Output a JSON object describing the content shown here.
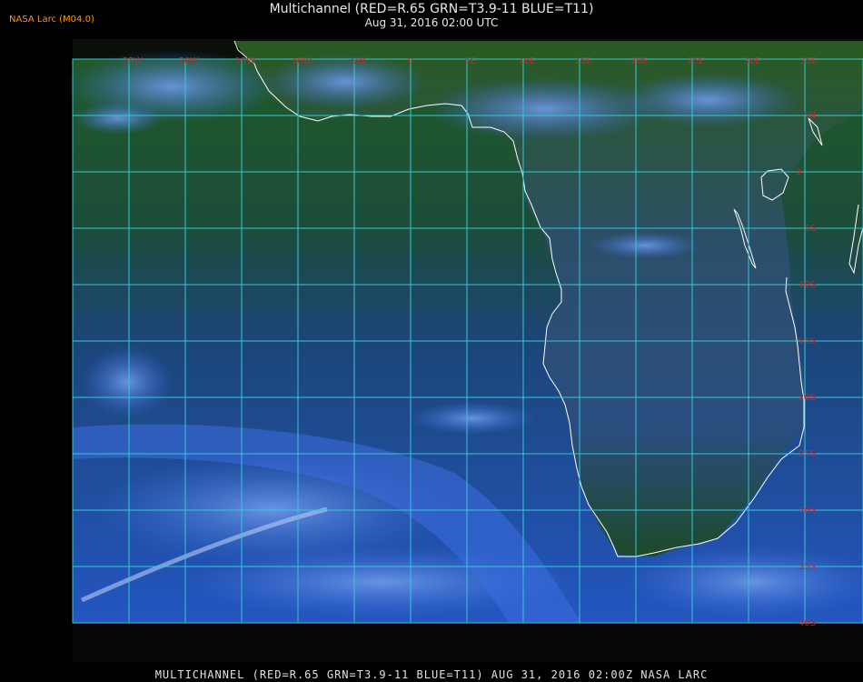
{
  "header": {
    "title": "Multichannel (RED=R.65 GRN=T3.9-11 BLUE=T11)",
    "subtitle": "Aug 31, 2016 02:00 UTC",
    "producer": "NASA Larc (M04.0)"
  },
  "footer": {
    "caption": "MULTICHANNEL (RED=R.65 GRN=T3.9-11 BLUE=T11) AUG 31, 2016 02:00Z   NASA LARC"
  },
  "map": {
    "longitude_labels": [
      "25W",
      "20W",
      "15W",
      "10W",
      "5W",
      "0",
      "5E",
      "10E",
      "15E",
      "20E",
      "25E",
      "30E",
      "35E"
    ],
    "latitude_labels": [
      "5N",
      "0",
      "5S",
      "10S",
      "15S",
      "20S",
      "25S",
      "30S",
      "35S",
      "40S"
    ],
    "colors": {
      "grid": "#35c8d8",
      "labels": "#cc2222",
      "coastline": "#ffffff",
      "ocean_cloud": "#1f4fb8",
      "land": "#1e4a1e"
    }
  }
}
